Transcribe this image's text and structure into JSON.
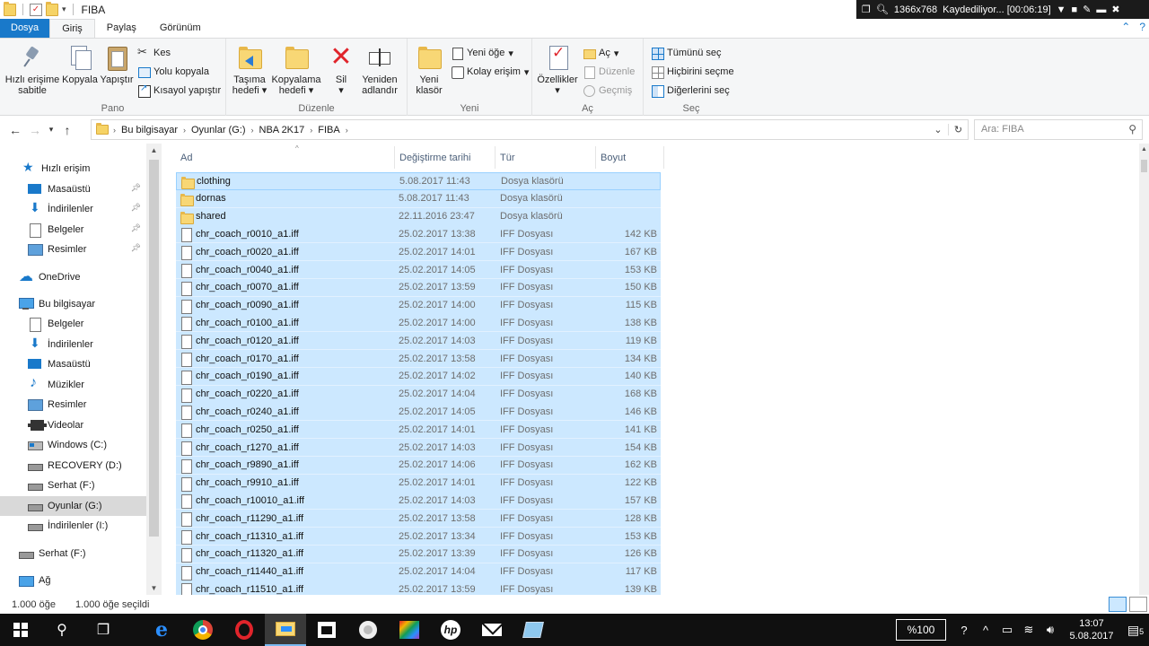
{
  "window": {
    "title": "FIBA",
    "recorder": {
      "resolution": "1366x768",
      "status": "Kaydediliyor... [00:06:19]"
    }
  },
  "tabs": [
    {
      "label": "Dosya"
    },
    {
      "label": "Giriş"
    },
    {
      "label": "Paylaş"
    },
    {
      "label": "Görünüm"
    }
  ],
  "ribbon": {
    "pano": {
      "label": "Pano",
      "pin_l1": "Hızlı erişime",
      "pin_l2": "sabitle",
      "copy": "Kopyala",
      "paste": "Yapıştır",
      "cut": "Kes",
      "copy_path": "Yolu kopyala",
      "paste_shortcut": "Kısayol yapıştır"
    },
    "duzenle": {
      "label": "Düzenle",
      "move_l1": "Taşıma",
      "move_l2": "hedefi",
      "copyto_l1": "Kopyalama",
      "copyto_l2": "hedefi",
      "delete": "Sil",
      "rename_l1": "Yeniden",
      "rename_l2": "adlandır"
    },
    "yeni": {
      "label": "Yeni",
      "new_folder_l1": "Yeni",
      "new_folder_l2": "klasör",
      "new_item": "Yeni öğe",
      "easy_access": "Kolay erişim"
    },
    "ac": {
      "label": "Aç",
      "properties": "Özellikler",
      "open": "Aç",
      "edit": "Düzenle",
      "history": "Geçmiş"
    },
    "sec": {
      "label": "Seç",
      "select_all": "Tümünü seç",
      "select_none": "Hiçbirini seçme",
      "invert": "Diğerlerini seç"
    }
  },
  "address": {
    "crumbs": [
      "Bu bilgisayar",
      "Oyunlar (G:)",
      "NBA 2K17",
      "FIBA"
    ],
    "search_placeholder": "Ara: FIBA"
  },
  "sidebar": {
    "items": [
      {
        "label": "Hızlı erişim"
      },
      {
        "label": "Masaüstü"
      },
      {
        "label": "İndirilenler"
      },
      {
        "label": "Belgeler"
      },
      {
        "label": "Resimler"
      },
      {
        "label": "OneDrive"
      },
      {
        "label": "Bu bilgisayar"
      },
      {
        "label": "Belgeler"
      },
      {
        "label": "İndirilenler"
      },
      {
        "label": "Masaüstü"
      },
      {
        "label": "Müzikler"
      },
      {
        "label": "Resimler"
      },
      {
        "label": "Videolar"
      },
      {
        "label": "Windows (C:)"
      },
      {
        "label": "RECOVERY (D:)"
      },
      {
        "label": "Serhat  (F:)"
      },
      {
        "label": "Oyunlar (G:)"
      },
      {
        "label": "İndirilenler (I:)"
      },
      {
        "label": "Serhat  (F:)"
      },
      {
        "label": "Ağ"
      }
    ]
  },
  "columns": {
    "name": "Ad",
    "date": "Değiştirme tarihi",
    "type": "Tür",
    "size": "Boyut"
  },
  "files": [
    {
      "name": "clothing",
      "date": "5.08.2017 11:43",
      "type": "Dosya klasörü",
      "size": ""
    },
    {
      "name": "dornas",
      "date": "5.08.2017 11:43",
      "type": "Dosya klasörü",
      "size": ""
    },
    {
      "name": "shared",
      "date": "22.11.2016 23:47",
      "type": "Dosya klasörü",
      "size": ""
    },
    {
      "name": "chr_coach_r0010_a1.iff",
      "date": "25.02.2017 13:38",
      "type": "IFF Dosyası",
      "size": "142 KB"
    },
    {
      "name": "chr_coach_r0020_a1.iff",
      "date": "25.02.2017 14:01",
      "type": "IFF Dosyası",
      "size": "167 KB"
    },
    {
      "name": "chr_coach_r0040_a1.iff",
      "date": "25.02.2017 14:05",
      "type": "IFF Dosyası",
      "size": "153 KB"
    },
    {
      "name": "chr_coach_r0070_a1.iff",
      "date": "25.02.2017 13:59",
      "type": "IFF Dosyası",
      "size": "150 KB"
    },
    {
      "name": "chr_coach_r0090_a1.iff",
      "date": "25.02.2017 14:00",
      "type": "IFF Dosyası",
      "size": "115 KB"
    },
    {
      "name": "chr_coach_r0100_a1.iff",
      "date": "25.02.2017 14:00",
      "type": "IFF Dosyası",
      "size": "138 KB"
    },
    {
      "name": "chr_coach_r0120_a1.iff",
      "date": "25.02.2017 14:03",
      "type": "IFF Dosyası",
      "size": "119 KB"
    },
    {
      "name": "chr_coach_r0170_a1.iff",
      "date": "25.02.2017 13:58",
      "type": "IFF Dosyası",
      "size": "134 KB"
    },
    {
      "name": "chr_coach_r0190_a1.iff",
      "date": "25.02.2017 14:02",
      "type": "IFF Dosyası",
      "size": "140 KB"
    },
    {
      "name": "chr_coach_r0220_a1.iff",
      "date": "25.02.2017 14:04",
      "type": "IFF Dosyası",
      "size": "168 KB"
    },
    {
      "name": "chr_coach_r0240_a1.iff",
      "date": "25.02.2017 14:05",
      "type": "IFF Dosyası",
      "size": "146 KB"
    },
    {
      "name": "chr_coach_r0250_a1.iff",
      "date": "25.02.2017 14:01",
      "type": "IFF Dosyası",
      "size": "141 KB"
    },
    {
      "name": "chr_coach_r1270_a1.iff",
      "date": "25.02.2017 14:03",
      "type": "IFF Dosyası",
      "size": "154 KB"
    },
    {
      "name": "chr_coach_r9890_a1.iff",
      "date": "25.02.2017 14:06",
      "type": "IFF Dosyası",
      "size": "162 KB"
    },
    {
      "name": "chr_coach_r9910_a1.iff",
      "date": "25.02.2017 14:01",
      "type": "IFF Dosyası",
      "size": "122 KB"
    },
    {
      "name": "chr_coach_r10010_a1.iff",
      "date": "25.02.2017 14:03",
      "type": "IFF Dosyası",
      "size": "157 KB"
    },
    {
      "name": "chr_coach_r11290_a1.iff",
      "date": "25.02.2017 13:58",
      "type": "IFF Dosyası",
      "size": "128 KB"
    },
    {
      "name": "chr_coach_r11310_a1.iff",
      "date": "25.02.2017 13:34",
      "type": "IFF Dosyası",
      "size": "153 KB"
    },
    {
      "name": "chr_coach_r11320_a1.iff",
      "date": "25.02.2017 13:39",
      "type": "IFF Dosyası",
      "size": "126 KB"
    },
    {
      "name": "chr_coach_r11440_a1.iff",
      "date": "25.02.2017 14:04",
      "type": "IFF Dosyası",
      "size": "117 KB"
    },
    {
      "name": "chr_coach_r11510_a1.iff",
      "date": "25.02.2017 13:59",
      "type": "IFF Dosyası",
      "size": "139 KB"
    }
  ],
  "status": {
    "count": "1.000 öğe",
    "selected": "1.000 öğe seçildi"
  },
  "taskbar": {
    "zoom": "%100",
    "time": "13:07",
    "date": "5.08.2017",
    "notifications": "5"
  },
  "colors": {
    "accent": "#1979ca",
    "selection": "#cce8ff",
    "selection_border": "#99d1ff"
  }
}
